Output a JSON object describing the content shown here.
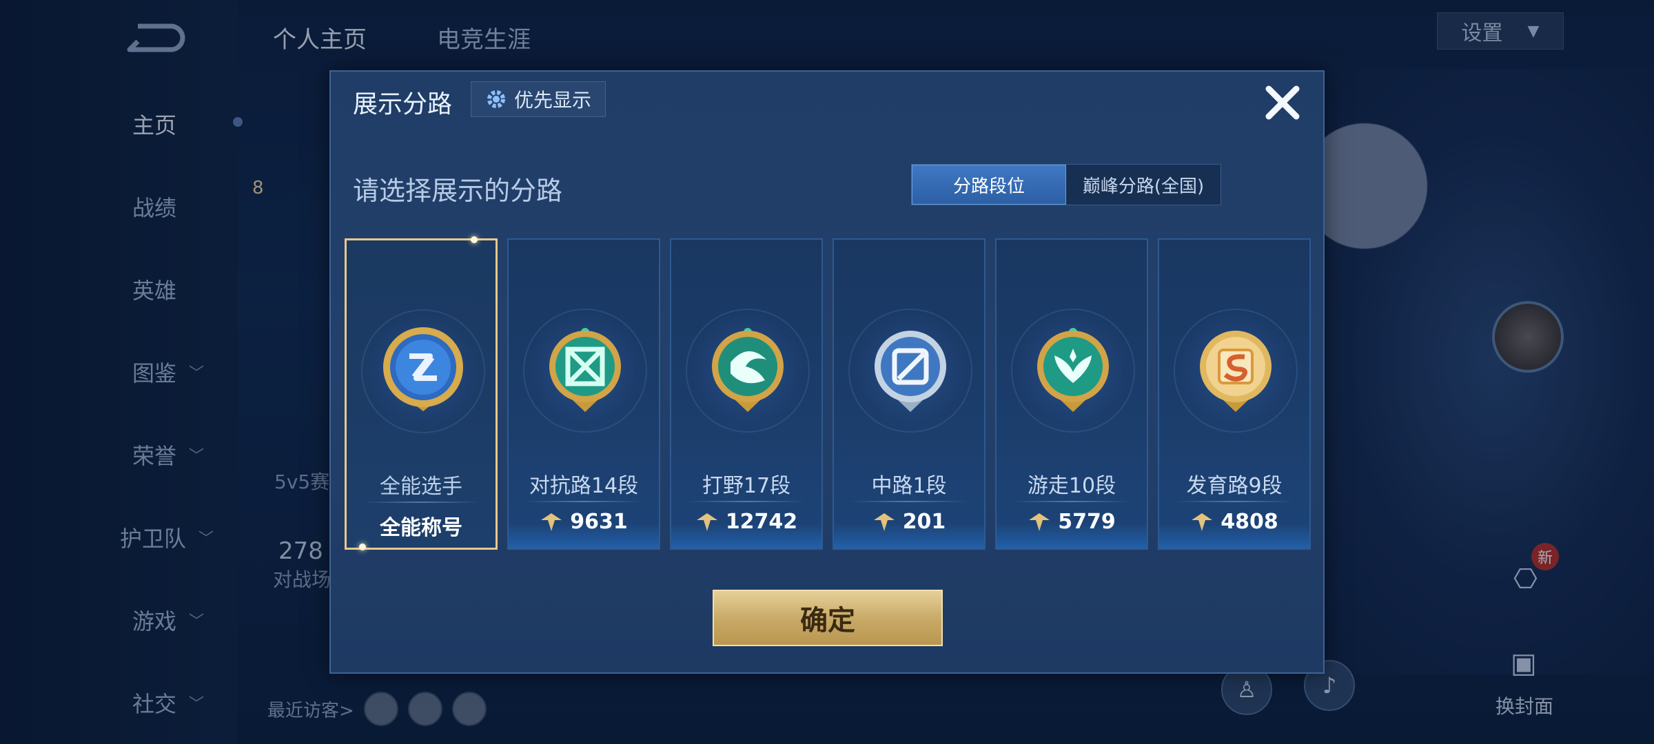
{
  "background": {
    "nav": [
      {
        "label": "主页",
        "active": true
      },
      {
        "label": "战绩"
      },
      {
        "label": "英雄"
      },
      {
        "label": "图鉴",
        "expandable": true
      },
      {
        "label": "荣誉",
        "expandable": true
      },
      {
        "label": "护卫队",
        "expandable": true
      },
      {
        "label": "游戏",
        "expandable": true
      },
      {
        "label": "社交",
        "expandable": true
      }
    ],
    "tabs": [
      "个人主页",
      "电竞生涯"
    ],
    "settings_label": "设置",
    "fragments": {
      "level": "8",
      "mode": "5v5赛",
      "count": "278",
      "count_label": "对战场"
    },
    "recent_visitors_label": "最近访客>",
    "change_cover_label": "换封面",
    "new_badge": "新"
  },
  "modal": {
    "title": "展示分路",
    "priority_label": "优先显示",
    "subtitle": "请选择展示的分路",
    "segments": [
      {
        "label": "分路段位",
        "active": true
      },
      {
        "label": "巅峰分路(全国)",
        "active": false
      }
    ],
    "cards": [
      {
        "name": "全能选手",
        "value": "全能称号",
        "selected": true,
        "badge": "allround-badge-icon"
      },
      {
        "name": "对抗路14段",
        "value": "9631",
        "selected": false,
        "badge": "clash-lane-badge-icon"
      },
      {
        "name": "打野17段",
        "value": "12742",
        "selected": false,
        "badge": "jungle-badge-icon"
      },
      {
        "name": "中路1段",
        "value": "201",
        "selected": false,
        "badge": "mid-lane-badge-icon"
      },
      {
        "name": "游走10段",
        "value": "5779",
        "selected": false,
        "badge": "roam-badge-icon"
      },
      {
        "name": "发育路9段",
        "value": "4808",
        "selected": false,
        "badge": "farm-lane-badge-icon"
      }
    ],
    "confirm_label": "确定"
  },
  "colors": {
    "accent_gold": "#e8c98a",
    "active_segment": "#3f78c3",
    "modal_bg": "#22406b"
  }
}
